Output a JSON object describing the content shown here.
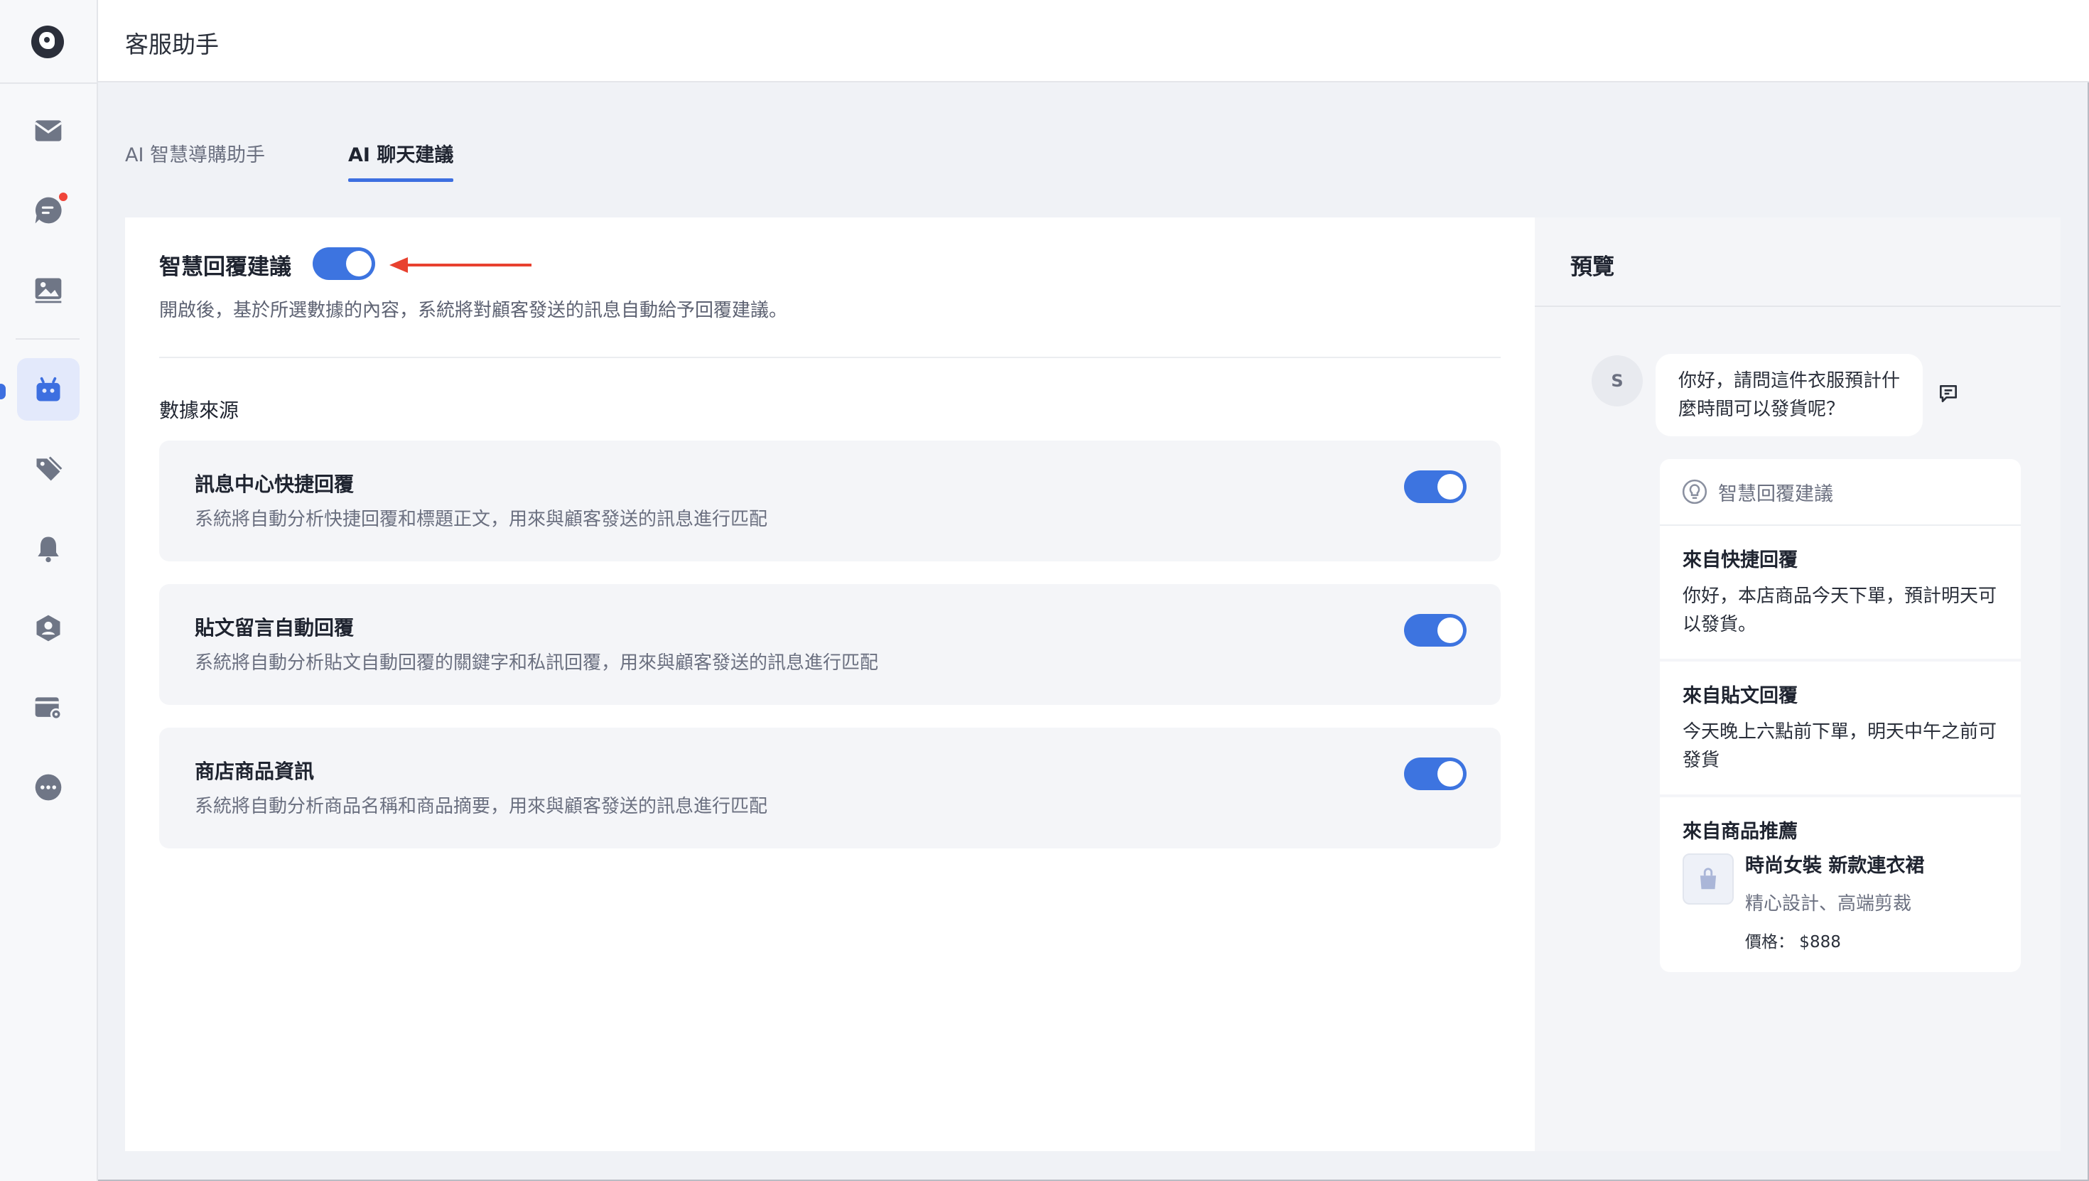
{
  "header": {
    "title": "客服助手"
  },
  "sidebar": {
    "items": [
      {
        "name": "inbox",
        "icon": "mail-icon"
      },
      {
        "name": "chat",
        "icon": "chat-bubble-icon",
        "badge": true
      },
      {
        "name": "media",
        "icon": "image-icon"
      },
      {
        "name": "assistant",
        "icon": "robot-icon",
        "active": true
      },
      {
        "name": "tags",
        "icon": "tag-icon"
      },
      {
        "name": "notifications",
        "icon": "bell-icon"
      },
      {
        "name": "contacts",
        "icon": "user-shield-icon"
      },
      {
        "name": "settings-card",
        "icon": "card-gear-icon"
      },
      {
        "name": "more",
        "icon": "more-icon"
      }
    ]
  },
  "tabs": [
    {
      "label": "AI 智慧導購助手",
      "active": false
    },
    {
      "label": "AI 聊天建議",
      "active": true
    }
  ],
  "main": {
    "title": "智慧回覆建議",
    "enabled": true,
    "description": "開啟後，基於所選數據的內容，系統將對顧客發送的訊息自動給予回覆建議。",
    "section_label": "數據來源",
    "sources": [
      {
        "title": "訊息中心快捷回覆",
        "description": "系統將自動分析快捷回覆和標題正文，用來與顧客發送的訊息進行匹配",
        "enabled": true
      },
      {
        "title": "貼文留言自動回覆",
        "description": "系統將自動分析貼文自動回覆的關鍵字和私訊回覆，用來與顧客發送的訊息進行匹配",
        "enabled": true
      },
      {
        "title": "商店商品資訊",
        "description": "系統將自動分析商品名稱和商品摘要，用來與顧客發送的訊息進行匹配",
        "enabled": true
      }
    ]
  },
  "preview": {
    "title": "預覽",
    "avatar_letter": "S",
    "customer_message": "你好，請問這件衣服預計什麼時間可以發貨呢？",
    "suggestion_header": "智慧回覆建議",
    "suggestions": [
      {
        "heading": "來自快捷回覆",
        "body": "你好，本店商品今天下單，預計明天可以發貨。"
      },
      {
        "heading": "來自貼文回覆",
        "body": "今天晚上六點前下單，明天中午之前可發貨"
      }
    ],
    "product_suggestion": {
      "heading": "來自商品推薦",
      "name": "時尚女裝 新款連衣裙",
      "description": "精心設計、高端剪裁",
      "price": "價格： $888"
    }
  },
  "colors": {
    "accent": "#3d74e0",
    "badge": "#f0453a",
    "arrow": "#e8412f",
    "active_nav_bg": "#e3e9fb"
  }
}
